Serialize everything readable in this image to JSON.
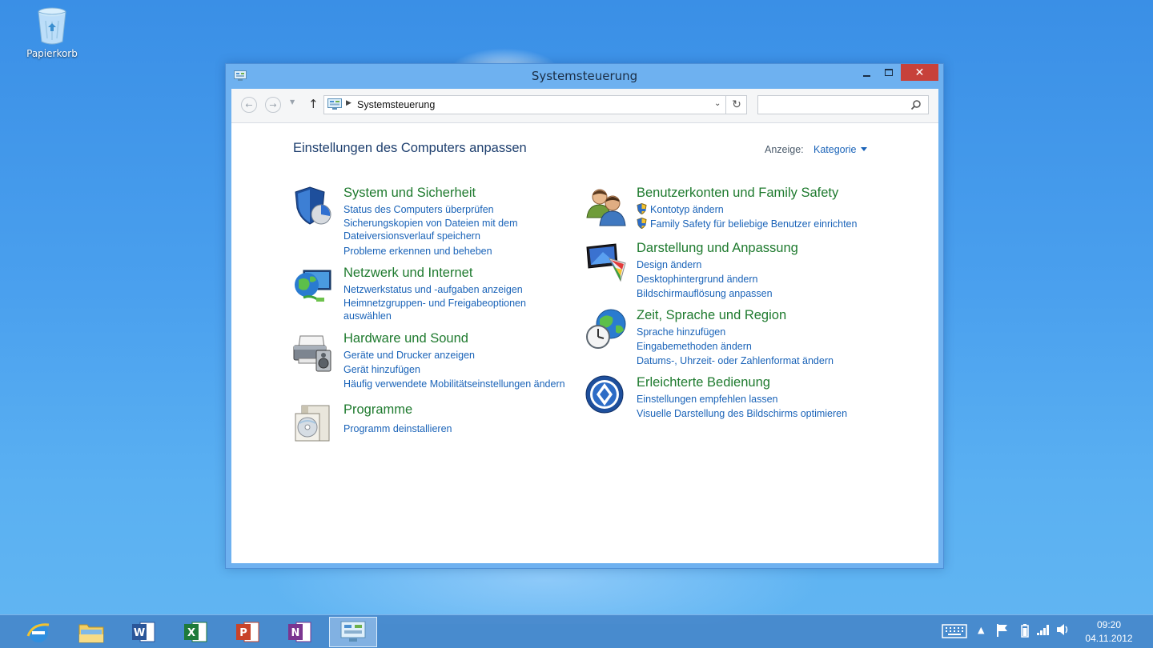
{
  "desktop": {
    "recycle_bin_label": "Papierkorb"
  },
  "window": {
    "title": "Systemsteuerung",
    "close_symbol": "✕",
    "address_path": "Systemsteuerung",
    "search_placeholder": ""
  },
  "content": {
    "heading": "Einstellungen des Computers anpassen",
    "view_label": "Anzeige:",
    "view_value": "Kategorie"
  },
  "categories": [
    {
      "title": "System und Sicherheit",
      "icon": "shield-icon",
      "links": [
        "Status des Computers überprüfen",
        "Sicherungskopien von Dateien mit dem Dateiversionsverlauf speichern",
        "Probleme erkennen und beheben"
      ]
    },
    {
      "title": "Netzwerk und Internet",
      "icon": "network-globe-icon",
      "links": [
        "Netzwerkstatus und -aufgaben anzeigen",
        "Heimnetzgruppen- und Freigabeoptionen auswählen"
      ]
    },
    {
      "title": "Hardware und Sound",
      "icon": "printer-speaker-icon",
      "links": [
        "Geräte und Drucker anzeigen",
        "Gerät hinzufügen",
        "Häufig verwendete Mobilitätseinstellungen ändern"
      ]
    },
    {
      "title": "Programme",
      "icon": "programs-disc-icon",
      "links": [
        "Programm deinstallieren"
      ]
    },
    {
      "title": "Benutzerkonten und Family Safety",
      "icon": "users-icon",
      "links": [
        "Kontotyp ändern",
        "Family Safety für beliebige Benutzer einrichten"
      ]
    },
    {
      "title": "Darstellung und Anpassung",
      "icon": "monitor-palette-icon",
      "links": [
        "Design ändern",
        "Desktophintergrund ändern",
        "Bildschirmauflösung anpassen"
      ]
    },
    {
      "title": "Zeit, Sprache und Region",
      "icon": "clock-globe-icon",
      "links": [
        "Sprache hinzufügen",
        "Eingabemethoden ändern",
        "Datums-, Uhrzeit- oder Zahlenformat ändern"
      ]
    },
    {
      "title": "Erleichterte Bedienung",
      "icon": "ease-of-access-icon",
      "links": [
        "Einstellungen empfehlen lassen",
        "Visuelle Darstellung des Bildschirms optimieren"
      ]
    }
  ],
  "taskbar": {
    "apps": [
      "internet-explorer",
      "file-explorer",
      "word",
      "excel",
      "powerpoint",
      "onenote",
      "control-panel"
    ],
    "time": "09:20",
    "date": "04.11.2012"
  },
  "colors": {
    "category_title": "#1e7a2e",
    "link": "#1a63b8",
    "close_button": "#c7413a"
  }
}
